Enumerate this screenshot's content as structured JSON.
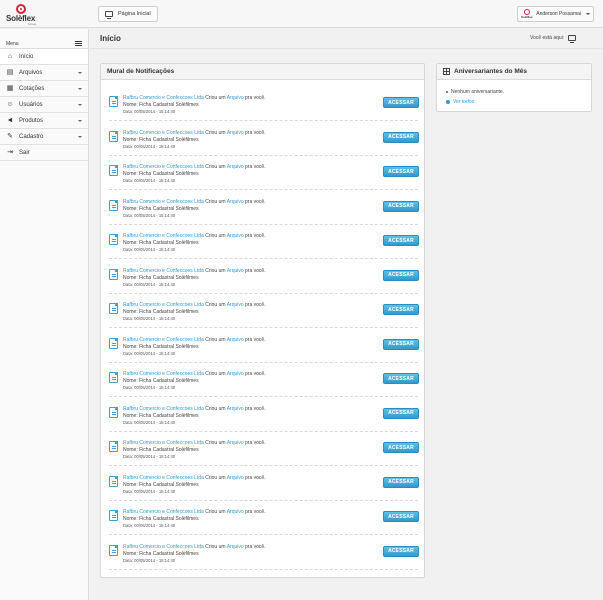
{
  "header": {
    "logo_text": "Solèflex",
    "logo_sub": "Group",
    "home_button_label": "Página Inicial",
    "user_logo_text": "Solèflex",
    "user_name": "Anderson Possamai"
  },
  "sidebar": {
    "menu_title": "Menu",
    "items": [
      {
        "label": "Início",
        "icon": "home-icon",
        "has_submenu": false
      },
      {
        "label": "Arquivos",
        "icon": "folder-icon",
        "has_submenu": true
      },
      {
        "label": "Cotações",
        "icon": "chart-icon",
        "has_submenu": true
      },
      {
        "label": "Usuários",
        "icon": "users-icon",
        "has_submenu": true
      },
      {
        "label": "Produtos",
        "icon": "megaphone-icon",
        "has_submenu": true
      },
      {
        "label": "Cadastro",
        "icon": "pencil-icon",
        "has_submenu": true
      },
      {
        "label": "Sair",
        "icon": "logout-icon",
        "has_submenu": false
      }
    ]
  },
  "main": {
    "page_title": "Início",
    "breadcrumb_label": "Você está aqui:"
  },
  "notifications": {
    "title": "Mural de Notificações",
    "items": [
      {
        "company": "Rafbru Comercio e Confeccoes Ltda",
        "action": "Criou um",
        "object": "Arquivo",
        "suffix": "pra você.",
        "name": "Nome: Ficha Cadastral Solèfilmes",
        "date": "Data: 00/05/2014 - 15:14:40",
        "button": "ACESSAR"
      },
      {
        "company": "Rafbru Comercio e Confeccoes Ltda",
        "action": "Criou um",
        "object": "Arquivo",
        "suffix": "pra você.",
        "name": "Nome: Ficha Cadastral Solèfilmes",
        "date": "Data: 00/05/2014 - 15:14:40",
        "button": "ACESSAR"
      },
      {
        "company": "Rafbru Comercio e Confeccoes Ltda",
        "action": "Criou um",
        "object": "Arquivo",
        "suffix": "pra você.",
        "name": "Nome: Ficha Cadastral Solèfilmes",
        "date": "Data: 00/05/2014 - 15:14:40",
        "button": "ACESSAR"
      },
      {
        "company": "Rafbru Comercio e Confeccoes Ltda",
        "action": "Criou um",
        "object": "Arquivo",
        "suffix": "pra você.",
        "name": "Nome: Ficha Cadastral Solèfilmes",
        "date": "Data: 00/05/2014 - 15:14:40",
        "button": "ACESSAR"
      },
      {
        "company": "Rafbru Comercio e Confeccoes Ltda",
        "action": "Criou um",
        "object": "Arquivo",
        "suffix": "pra você.",
        "name": "Nome: Ficha Cadastral Solèfilmes",
        "date": "Data: 00/05/2014 - 15:14:40",
        "button": "ACESSAR"
      },
      {
        "company": "Rafbru Comercio e Confeccoes Ltda",
        "action": "Criou um",
        "object": "Arquivo",
        "suffix": "pra você.",
        "name": "Nome: Ficha Cadastral Solèfilmes",
        "date": "Data: 00/05/2014 - 15:14:40",
        "button": "ACESSAR"
      },
      {
        "company": "Rafbru Comercio e Confeccoes Ltda",
        "action": "Criou um",
        "object": "Arquivo",
        "suffix": "pra você.",
        "name": "Nome: Ficha Cadastral Solèfilmes",
        "date": "Data: 00/05/2014 - 15:14:40",
        "button": "ACESSAR"
      },
      {
        "company": "Rafbru Comercio e Confeccoes Ltda",
        "action": "Criou um",
        "object": "Arquivo",
        "suffix": "pra você.",
        "name": "Nome: Ficha Cadastral Solèfilmes",
        "date": "Data: 00/05/2014 - 15:14:40",
        "button": "ACESSAR"
      },
      {
        "company": "Rafbru Comercio e Confeccoes Ltda",
        "action": "Criou um",
        "object": "Arquivo",
        "suffix": "pra você.",
        "name": "Nome: Ficha Cadastral Solèfilmes",
        "date": "Data: 00/05/2014 - 15:14:40",
        "button": "ACESSAR"
      },
      {
        "company": "Rafbru Comercio e Confeccoes Ltda",
        "action": "Criou um",
        "object": "Arquivo",
        "suffix": "pra você.",
        "name": "Nome: Ficha Cadastral Solèfilmes",
        "date": "Data: 00/05/2014 - 15:14:40",
        "button": "ACESSAR"
      },
      {
        "company": "Rafbru Comercio e Confeccoes Ltda",
        "action": "Criou um",
        "object": "Arquivo",
        "suffix": "pra você.",
        "name": "Nome: Ficha Cadastral Solèfilmes",
        "date": "Data: 00/05/2014 - 15:14:40",
        "button": "ACESSAR"
      },
      {
        "company": "Rafbru Comercio e Confeccoes Ltda",
        "action": "Criou um",
        "object": "Arquivo",
        "suffix": "pra você.",
        "name": "Nome: Ficha Cadastral Solèfilmes",
        "date": "Data: 00/05/2014 - 15:14:40",
        "button": "ACESSAR"
      },
      {
        "company": "Rafbru Comercio e Confeccoes Ltda",
        "action": "Criou um",
        "object": "Arquivo",
        "suffix": "pra você.",
        "name": "Nome: Ficha Cadastral Solèfilmes",
        "date": "Data: 00/05/2014 - 15:14:40",
        "button": "ACESSAR"
      },
      {
        "company": "Rafbru Comercio e Confeccoes Ltda",
        "action": "Criou um",
        "object": "Arquivo",
        "suffix": "pra você.",
        "name": "Nome: Ficha Cadastral Solèfilmes",
        "date": "Data: 00/05/2014 - 15:14:40",
        "button": "ACESSAR"
      }
    ]
  },
  "birthdays": {
    "title": "Aniversariantes do Mês",
    "empty_text": "Nenhum aniversariante.",
    "link_text": "Ver todos"
  },
  "colors": {
    "accent": "#2e9bd6",
    "button": "#3399cc",
    "brand": "#d6203a"
  }
}
